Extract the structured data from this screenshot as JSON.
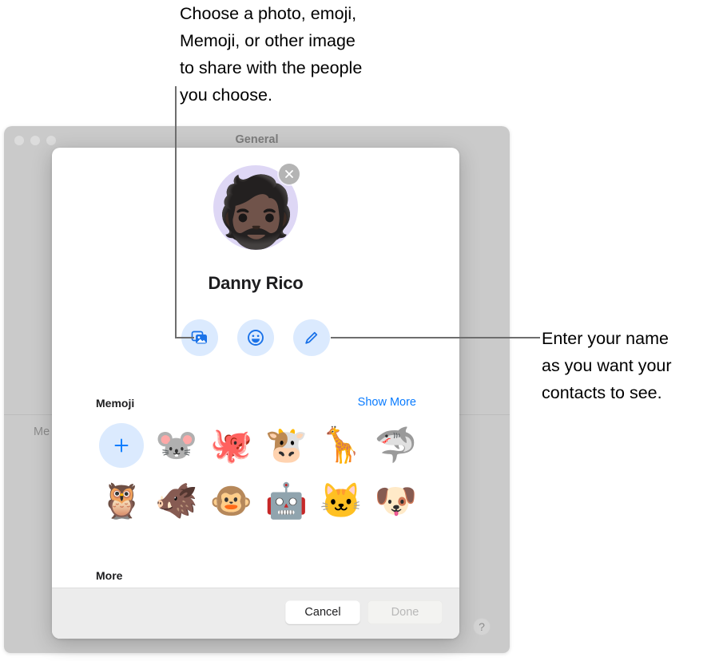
{
  "annotations": [
    {
      "id": "photo",
      "text": "Choose a photo, emoji,\nMemoji, or other image\nto share with the people\nyou choose."
    },
    {
      "id": "name",
      "text": "Enter your name\nas you want your\ncontacts to see."
    }
  ],
  "background_window": {
    "title": "General",
    "partial_label": "Me",
    "help_glyph": "?",
    "traffic_lights": [
      "close",
      "minimize",
      "maximize"
    ]
  },
  "sheet": {
    "avatar": {
      "glyph": "🧔🏿",
      "background_color": "#ded7f5",
      "close_label": "Remove picture"
    },
    "display_name": "Danny Rico",
    "actions": [
      {
        "name": "photos",
        "label": "Choose photo"
      },
      {
        "name": "emoji",
        "label": "Choose emoji"
      },
      {
        "name": "edit",
        "label": "Edit"
      }
    ],
    "memoji_section": {
      "title": "Memoji",
      "show_more_label": "Show More",
      "add_label": "Create new Memoji",
      "items": [
        {
          "name": "add",
          "glyph": ""
        },
        {
          "name": "mouse",
          "glyph": "🐭"
        },
        {
          "name": "octopus",
          "glyph": "🐙"
        },
        {
          "name": "cow",
          "glyph": "🐮"
        },
        {
          "name": "giraffe",
          "glyph": "🦒"
        },
        {
          "name": "shark",
          "glyph": "🦈"
        },
        {
          "name": "owl",
          "glyph": "🦉"
        },
        {
          "name": "boar",
          "glyph": "🐗"
        },
        {
          "name": "monkey",
          "glyph": "🐵"
        },
        {
          "name": "robot",
          "glyph": "🤖"
        },
        {
          "name": "cat",
          "glyph": "🐱"
        },
        {
          "name": "dog",
          "glyph": "🐶"
        }
      ]
    },
    "more_section": {
      "title": "More"
    },
    "footer": {
      "cancel_label": "Cancel",
      "done_label": "Done",
      "done_disabled": true
    }
  },
  "colors": {
    "accent_blue": "#0a7cff",
    "action_bg": "#dbeafe",
    "window_chrome": "#cacaca",
    "avatar_bg": "#ded7f5"
  }
}
